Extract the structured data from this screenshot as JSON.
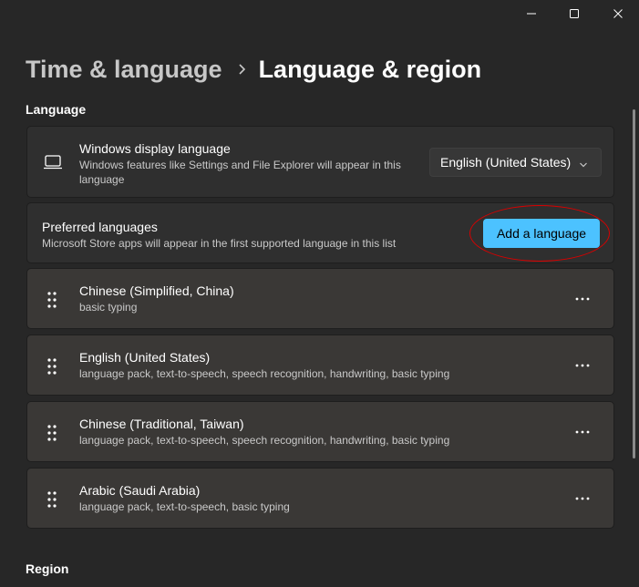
{
  "window": {
    "minimize_icon": "minimize-icon",
    "maximize_icon": "maximize-icon",
    "close_icon": "close-icon"
  },
  "breadcrumb": {
    "parent": "Time & language",
    "separator_icon": "chevron-right-icon",
    "current": "Language & region"
  },
  "language_section": {
    "title": "Language",
    "display_language": {
      "icon": "laptop-icon",
      "title": "Windows display language",
      "description": "Windows features like Settings and File Explorer will appear in this language",
      "selected": "English (United States)"
    },
    "preferred": {
      "title": "Preferred languages",
      "description": "Microsoft Store apps will appear in the first supported language in this list",
      "add_button": "Add a language"
    },
    "languages": [
      {
        "name": "Chinese (Simplified, China)",
        "features": "basic typing"
      },
      {
        "name": "English (United States)",
        "features": "language pack, text-to-speech, speech recognition, handwriting, basic typing"
      },
      {
        "name": "Chinese (Traditional, Taiwan)",
        "features": "language pack, text-to-speech, speech recognition, handwriting, basic typing"
      },
      {
        "name": "Arabic (Saudi Arabia)",
        "features": "language pack, text-to-speech, basic typing"
      }
    ]
  },
  "region_section": {
    "title": "Region"
  },
  "colors": {
    "background": "#272727",
    "card": "#2f2f2f",
    "accent": "#4cc2ff",
    "highlight": "#d80000"
  }
}
